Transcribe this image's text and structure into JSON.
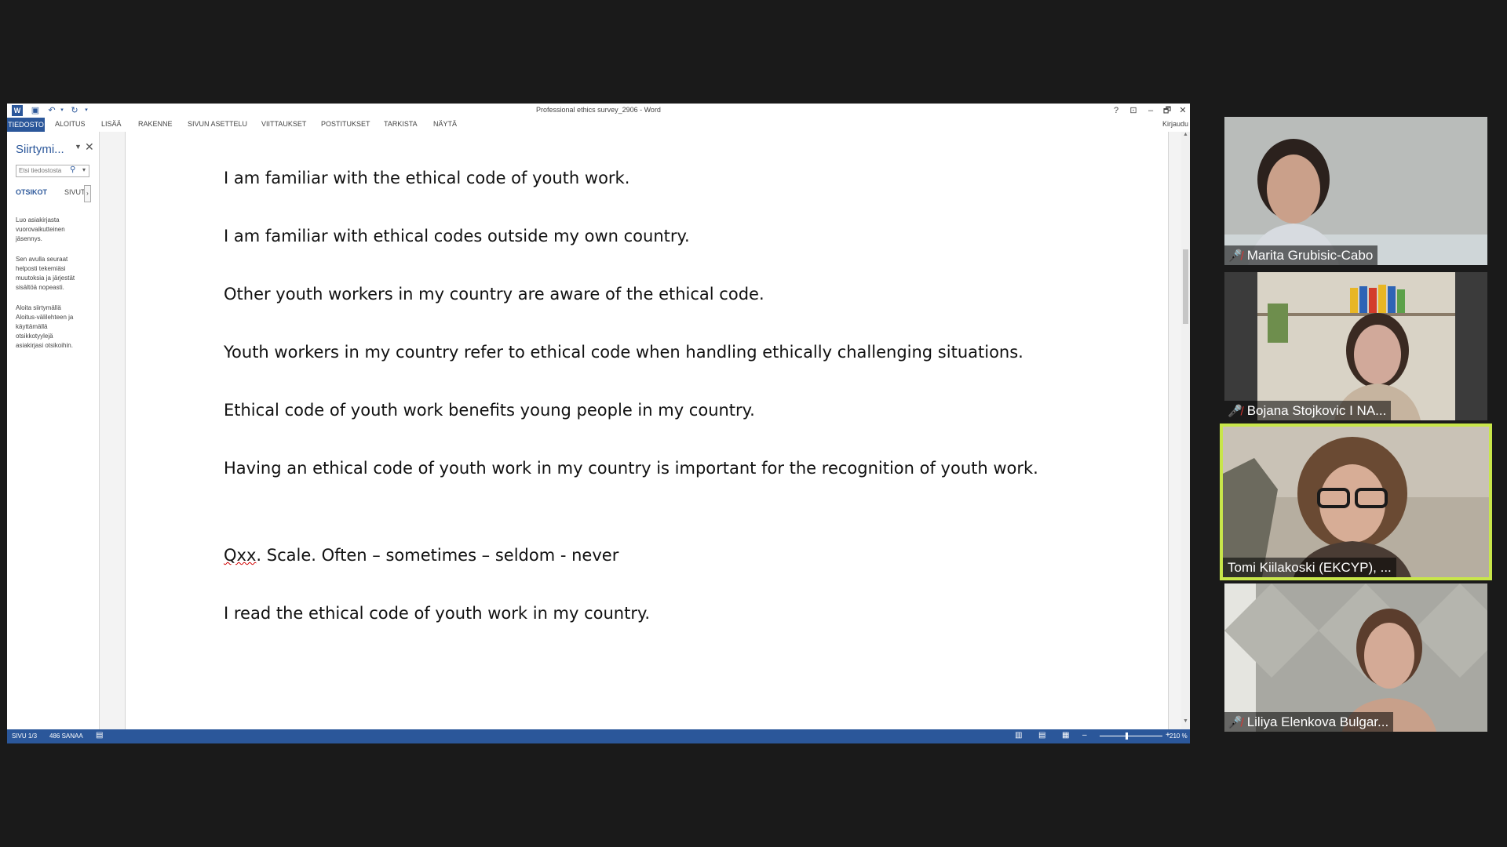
{
  "word": {
    "title": "Professional ethics survey_2906 - Word",
    "ribbon_tabs": [
      "TIEDOSTO",
      "ALOITUS",
      "LISÄÄ",
      "RAKENNE",
      "SIVUN ASETTELU",
      "VIITTAUKSET",
      "POSTITUKSET",
      "TARKISTA",
      "NÄYTÄ"
    ],
    "sign_in": "Kirjaudu",
    "window_buttons": [
      "?",
      "⊡",
      "–",
      "🗗",
      "✕"
    ]
  },
  "nav_pane": {
    "title": "Siirtymi...",
    "search_placeholder": "Etsi tiedostosta",
    "tab_headings": "OTSIKOT",
    "tab_pages": "SIVUT",
    "help_paragraphs": [
      [
        "Luo asiakirjasta",
        "vuorovaikutteinen",
        "jäsennys."
      ],
      [
        "Sen avulla seuraat",
        "helposti tekemiäsi",
        "muutoksia ja järjestät",
        "sisältöä nopeasti."
      ],
      [
        "Aloita siirtymällä",
        "Aloitus-välilehteen ja",
        "käyttämällä",
        "otsikkotyylejä",
        "asiakirjasi otsikoihin."
      ]
    ]
  },
  "document": {
    "lines": [
      "I am familiar with the ethical code of youth work.",
      "I am familiar with ethical codes outside my own country.",
      "Other youth workers in my country are aware of the ethical code.",
      "Youth workers in my country refer to ethical code when handling ethically challenging situations.",
      "Ethical code of youth work benefits young people in my country.",
      "Having an ethical code of youth work in my country is important for the recognition of youth work."
    ],
    "question_prefix": "Qxx",
    "question_rest": ". Scale. Often – sometimes – seldom - never",
    "last_line": "I read the ethical code of youth work in my country."
  },
  "status_bar": {
    "page": "SIVU 1/3",
    "words": "486 SANAA",
    "zoom": "210 %",
    "zoom_fraction": 0.42
  },
  "participants": [
    {
      "name": "Marita Grubisic-Cabo",
      "muted": true,
      "active": false
    },
    {
      "name": "Bojana Stojkovic I NA...",
      "muted": true,
      "active": false
    },
    {
      "name": "Tomi Kiilakoski (EKCYP), ...",
      "muted": false,
      "active": true
    },
    {
      "name": "Liliya Elenkova Bulgar...",
      "muted": true,
      "active": false
    }
  ],
  "colors": {
    "word_blue": "#2b579a",
    "active_speaker": "#c8e64a",
    "muted_mic": "#e0322f"
  }
}
